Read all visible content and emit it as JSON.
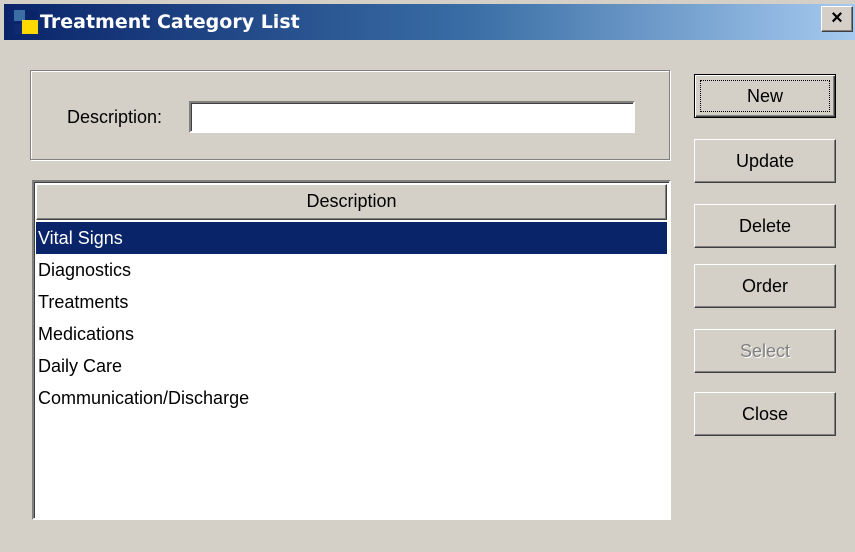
{
  "window": {
    "title": "Treatment Category List",
    "close_glyph": "×",
    "icon": "app-icon",
    "colors": {
      "titlebar_start": "#0a246a",
      "titlebar_end": "#a6caf0",
      "face": "#d4d0c8",
      "selection": "#0a246a"
    }
  },
  "filter": {
    "label": "Description:",
    "value": ""
  },
  "list": {
    "column_header": "Description",
    "items": [
      {
        "label": "Vital Signs",
        "selected": true
      },
      {
        "label": "Diagnostics",
        "selected": false
      },
      {
        "label": "Treatments",
        "selected": false
      },
      {
        "label": "Medications",
        "selected": false
      },
      {
        "label": "Daily Care",
        "selected": false
      },
      {
        "label": "Communication/Discharge",
        "selected": false
      }
    ]
  },
  "buttons": {
    "new": "New",
    "update": "Update",
    "delete": "Delete",
    "order": "Order",
    "select": "Select",
    "close": "Close"
  }
}
